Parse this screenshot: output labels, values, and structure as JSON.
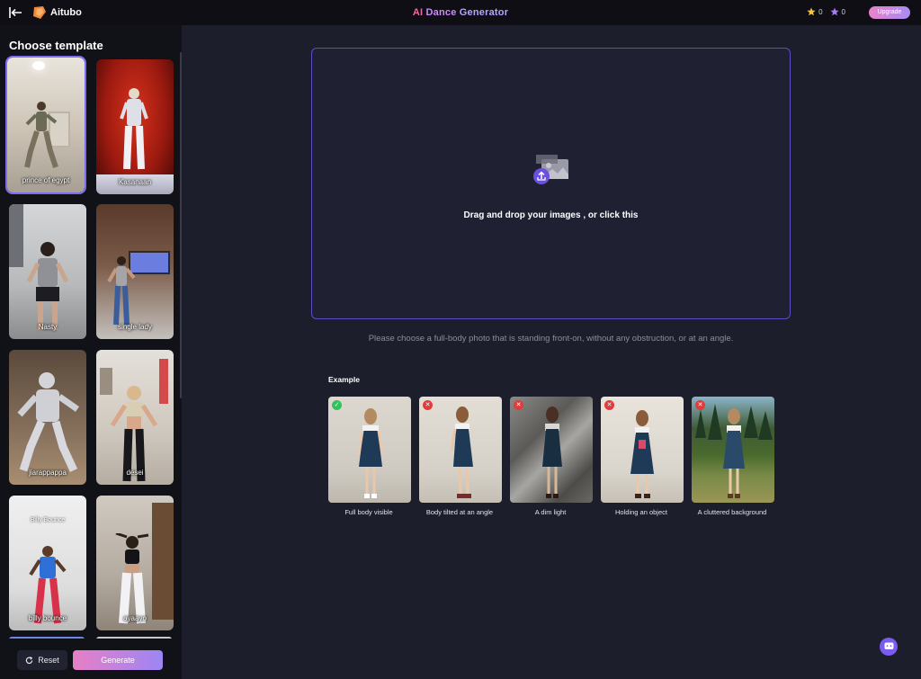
{
  "header": {
    "brand": "Aitubo",
    "title_ai": "AI",
    "title_dance": "Dance",
    "title_gen": "Generator",
    "credits_gold": "0",
    "credits_purple": "0",
    "upgrade_label": "Upgrade"
  },
  "sidebar": {
    "title": "Choose template",
    "templates": [
      {
        "label": "prince of egypt"
      },
      {
        "label": "Kasanaan"
      },
      {
        "label": "Nasty"
      },
      {
        "label": "single lady"
      },
      {
        "label": "jiarappappa"
      },
      {
        "label": "desei"
      },
      {
        "label": "billy bounce",
        "top_caption": "Billy Bounce"
      },
      {
        "label": "ayaayo"
      }
    ],
    "reset_label": "Reset",
    "generate_label": "Generate"
  },
  "main": {
    "drop_text": "Drag and drop your images , or click this",
    "hint": "Please choose a full-body photo that is standing front-on, without any obstruction, or at an angle.",
    "example_title": "Example",
    "examples": [
      {
        "label": "Full body visible",
        "ok": true
      },
      {
        "label": "Body tilted at an angle",
        "ok": false
      },
      {
        "label": "A dim light",
        "ok": false
      },
      {
        "label": "Holding an object",
        "ok": false
      },
      {
        "label": "A cluttered background",
        "ok": false
      }
    ]
  },
  "colors": {
    "accent": "#7b6cf0",
    "gradient_start": "#e77fc6",
    "gradient_end": "#9c86f5",
    "ok": "#2fc35a",
    "bad": "#e23b3b"
  }
}
